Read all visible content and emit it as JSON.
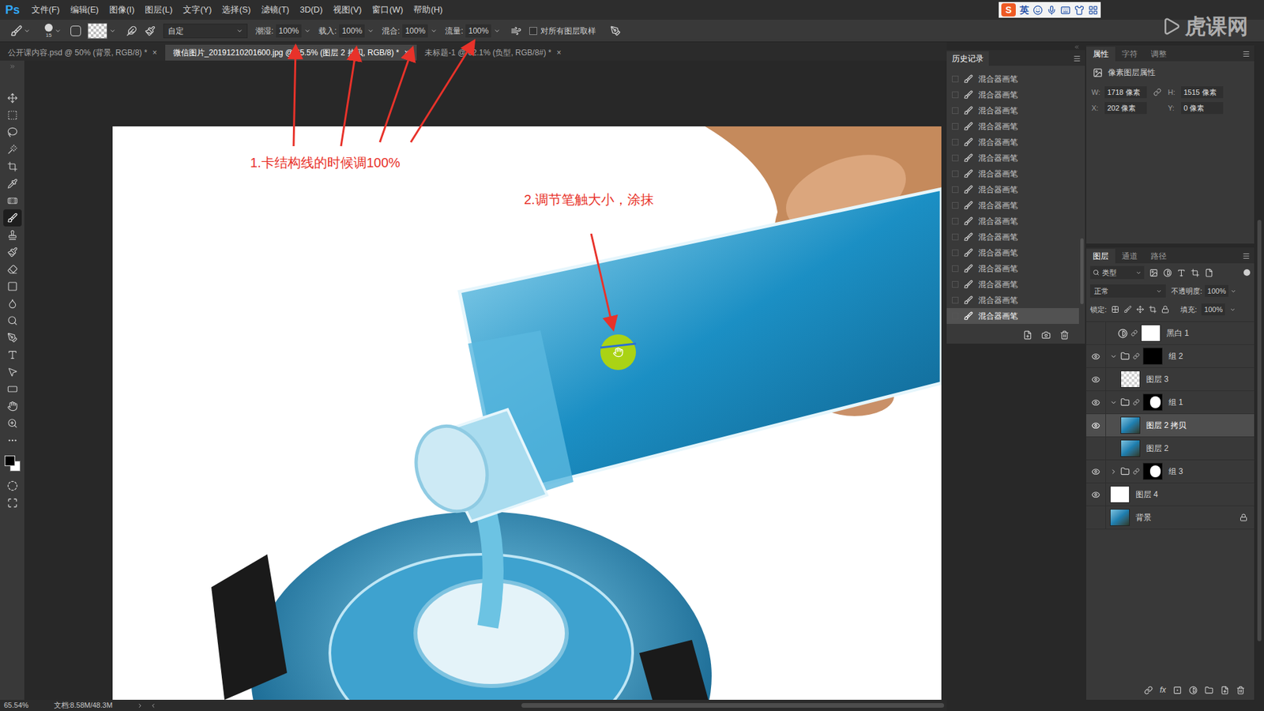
{
  "app": {
    "logo": "Ps"
  },
  "menu": [
    "文件(F)",
    "编辑(E)",
    "图像(I)",
    "图层(L)",
    "文字(Y)",
    "选择(S)",
    "滤镜(T)",
    "3D(D)",
    "视图(V)",
    "窗口(W)",
    "帮助(H)"
  ],
  "ime": {
    "logo": "S",
    "lang": "英"
  },
  "watermark": "虎课网",
  "options": {
    "brush_size": "15",
    "preset": "自定",
    "fields": [
      {
        "label": "潮湿:",
        "value": "100%"
      },
      {
        "label": "载入:",
        "value": "100%"
      },
      {
        "label": "混合:",
        "value": "100%"
      },
      {
        "label": "流量:",
        "value": "100%"
      }
    ],
    "sample_all": {
      "label": "对所有图层取样",
      "checked": false
    }
  },
  "tabs": [
    {
      "label": "公开课内容.psd @ 50% (背景, RGB/8) *",
      "selected": false
    },
    {
      "label": "微信图片_20191210201600.jpg @ 65.5% (图层 2 拷贝, RGB/8) *",
      "selected": true
    },
    {
      "label": "未标题-1 @ 62.1% (负型, RGB/8#) *",
      "selected": false
    }
  ],
  "tab_close": "×",
  "tools": [
    {
      "selected": false
    },
    {
      "selected": false
    },
    {
      "selected": false
    },
    {
      "selected": false
    },
    {
      "selected": false
    },
    {
      "selected": false
    },
    {
      "selected": false
    },
    {
      "selected": true
    },
    {
      "selected": false
    },
    {
      "selected": false
    },
    {
      "selected": false
    },
    {
      "selected": false
    },
    {
      "selected": false
    },
    {
      "selected": false
    },
    {
      "selected": false
    },
    {
      "selected": false
    },
    {
      "selected": false
    },
    {
      "selected": false
    },
    {
      "selected": false
    },
    {
      "selected": false
    },
    {
      "selected": false
    }
  ],
  "annotations": [
    {
      "text": "1.卡结构线的时候调100%"
    },
    {
      "text": "2.调节笔触大小，涂抹"
    }
  ],
  "history": {
    "title": "历史记录",
    "items": [
      {
        "label": "混合器画笔",
        "selected": false
      },
      {
        "label": "混合器画笔",
        "selected": false
      },
      {
        "label": "混合器画笔",
        "selected": false
      },
      {
        "label": "混合器画笔",
        "selected": false
      },
      {
        "label": "混合器画笔",
        "selected": false
      },
      {
        "label": "混合器画笔",
        "selected": false
      },
      {
        "label": "混合器画笔",
        "selected": false
      },
      {
        "label": "混合器画笔",
        "selected": false
      },
      {
        "label": "混合器画笔",
        "selected": false
      },
      {
        "label": "混合器画笔",
        "selected": false
      },
      {
        "label": "混合器画笔",
        "selected": false
      },
      {
        "label": "混合器画笔",
        "selected": false
      },
      {
        "label": "混合器画笔",
        "selected": false
      },
      {
        "label": "混合器画笔",
        "selected": false
      },
      {
        "label": "混合器画笔",
        "selected": false
      },
      {
        "label": "混合器画笔",
        "selected": true
      }
    ]
  },
  "properties": {
    "tabs": [
      {
        "label": "属性",
        "selected": true
      },
      {
        "label": "字符",
        "selected": false
      },
      {
        "label": "调整",
        "selected": false
      }
    ],
    "subtitle": "像素图层属性",
    "fields": [
      {
        "label": "W:",
        "value": "1718 像素"
      },
      {
        "label": "H:",
        "value": "1515 像素"
      },
      {
        "label": "X:",
        "value": "202 像素"
      },
      {
        "label": "Y:",
        "value": "0 像素"
      }
    ]
  },
  "layers": {
    "tabs": [
      {
        "label": "图层",
        "selected": true
      },
      {
        "label": "通道",
        "selected": false
      },
      {
        "label": "路径",
        "selected": false
      }
    ],
    "filter": "类型",
    "blend": "正常",
    "opacity_label": "不透明度:",
    "opacity": "100%",
    "lock_label": "锁定:",
    "fill_label": "填充:",
    "fill": "100%",
    "fx": "fx",
    "items": [
      {
        "name": "黑白 1",
        "kind": "adjustment",
        "thumb": "white",
        "visible": false,
        "selected": false,
        "locked": false,
        "depth": 0
      },
      {
        "name": "组 2",
        "kind": "group",
        "thumb": "black",
        "visible": true,
        "selected": false,
        "locked": false,
        "expanded": true,
        "depth": 0
      },
      {
        "name": "图层 3",
        "kind": "layer",
        "thumb": "checker",
        "visible": true,
        "selected": false,
        "locked": false,
        "depth": 1
      },
      {
        "name": "组 1",
        "kind": "group",
        "thumb": "mask",
        "visible": true,
        "selected": false,
        "locked": false,
        "expanded": true,
        "depth": 0
      },
      {
        "name": "图层 2 拷贝",
        "kind": "layer",
        "thumb": "photo",
        "visible": true,
        "selected": true,
        "locked": false,
        "depth": 1
      },
      {
        "name": "图层 2",
        "kind": "layer",
        "thumb": "photo",
        "visible": false,
        "selected": false,
        "locked": false,
        "depth": 1
      },
      {
        "name": "组 3",
        "kind": "group",
        "thumb": "mask",
        "visible": true,
        "selected": false,
        "locked": false,
        "expanded": false,
        "depth": 0
      },
      {
        "name": "图层 4",
        "kind": "layer",
        "thumb": "white",
        "visible": true,
        "selected": false,
        "locked": false,
        "depth": 0
      },
      {
        "name": "背景",
        "kind": "layer",
        "thumb": "photo",
        "visible": false,
        "selected": false,
        "locked": true,
        "depth": 0
      }
    ]
  },
  "status_bar": {
    "zoom": "65.54%",
    "doc": "文档:8.58M/48.3M"
  }
}
